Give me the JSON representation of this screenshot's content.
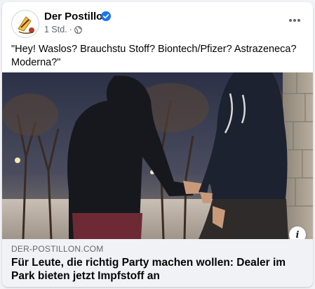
{
  "post": {
    "page_name": "Der Postillon",
    "timestamp": "1 Std.",
    "separator": "·",
    "caption": "\"Hey! Waslos? Brauchstu Stoff? Biontech/Pfizer? Astrazeneca? Moderna?\"",
    "link": {
      "domain": "DER-POSTILLON.COM",
      "headline": "Für Leute, die richtig Party machen wollen: Dealer im Park bieten jetzt Impfstoff an"
    },
    "icons": {
      "verified": "verified-badge-icon",
      "audience": "globe-icon",
      "more": "more-options-icon",
      "info": "info-icon"
    },
    "colors": {
      "verified_blue": "#1877f2",
      "secondary_text": "#65676b",
      "link_preview_bg": "#f0f2f5"
    }
  }
}
